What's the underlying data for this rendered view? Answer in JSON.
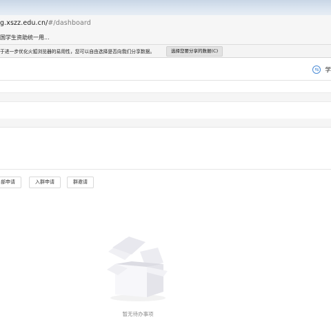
{
  "browser": {
    "url_host": "g.xszz.edu.cn/",
    "url_path": "#/dashboard",
    "bookmark": "国学生资助统一用...",
    "notification": {
      "message": "于进一步优化火狐浏览器的易用性，您可以自由选择是否向我们分享数据。",
      "button_label": "选择您要分享的数据(C)"
    }
  },
  "header": {
    "switch_icon": "switch-icon",
    "label": "学"
  },
  "tabs": [
    "部申请",
    "入群申请",
    "群邀请"
  ],
  "empty_state": {
    "icon": "empty-box-icon",
    "text": "暂无待办事项"
  }
}
